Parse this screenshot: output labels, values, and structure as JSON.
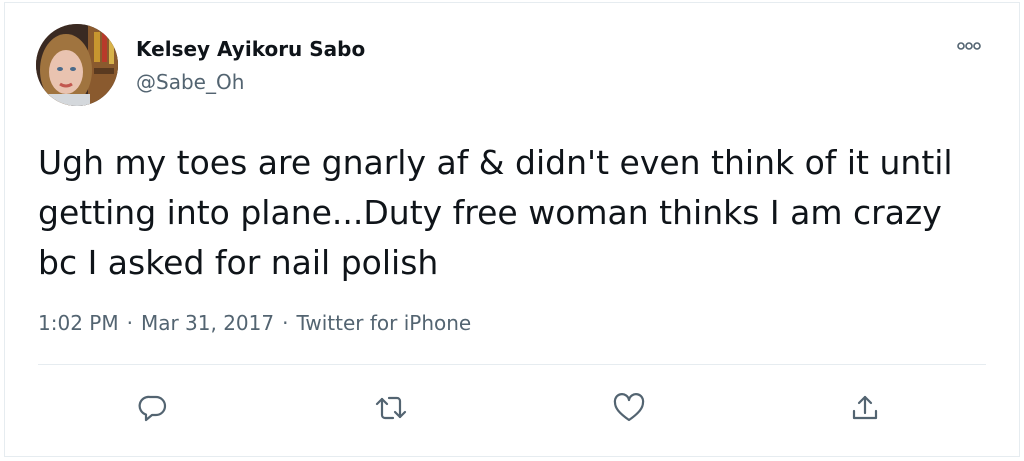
{
  "tweet": {
    "author_name": "Kelsey Ayikoru Sabo",
    "author_handle": "@Sabe_Oh",
    "text": "Ugh my toes are gnarly af & didn't even think of it until getting into plane...Duty free woman thinks I am crazy bc I asked for nail polish",
    "time": "1:02 PM",
    "date": "Mar 31, 2017",
    "source": "Twitter for iPhone",
    "meta_separator": "·"
  },
  "actions": {
    "reply_icon": "speech-bubble",
    "retweet_icon": "retweet-arrows",
    "like_icon": "heart",
    "share_icon": "upload-arrow",
    "more_icon": "three-dots"
  },
  "colors": {
    "text_primary": "#0f1419",
    "text_secondary": "#536471",
    "border": "#e6ecf0",
    "icon": "#536471"
  }
}
